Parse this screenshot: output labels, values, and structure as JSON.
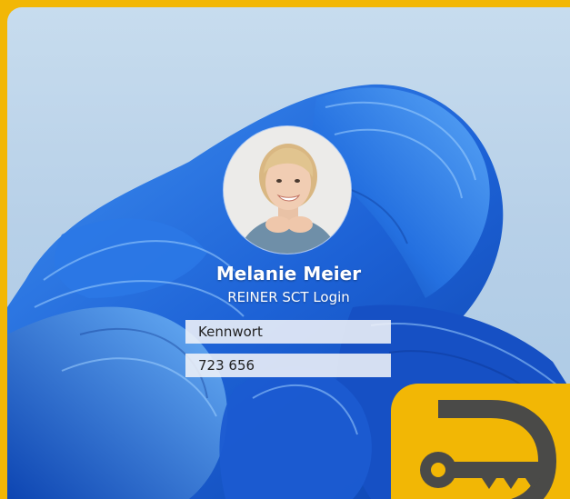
{
  "user": {
    "name": "Melanie Meier",
    "login_method": "REINER SCT Login"
  },
  "fields": {
    "password_placeholder": "Kennwort",
    "pin_value": "723 656"
  },
  "colors": {
    "frame": "#f2b705",
    "wallpaper_blue": "#1f63d8",
    "key_gray": "#4a4a48"
  },
  "icons": {
    "badge": "key-icon"
  }
}
